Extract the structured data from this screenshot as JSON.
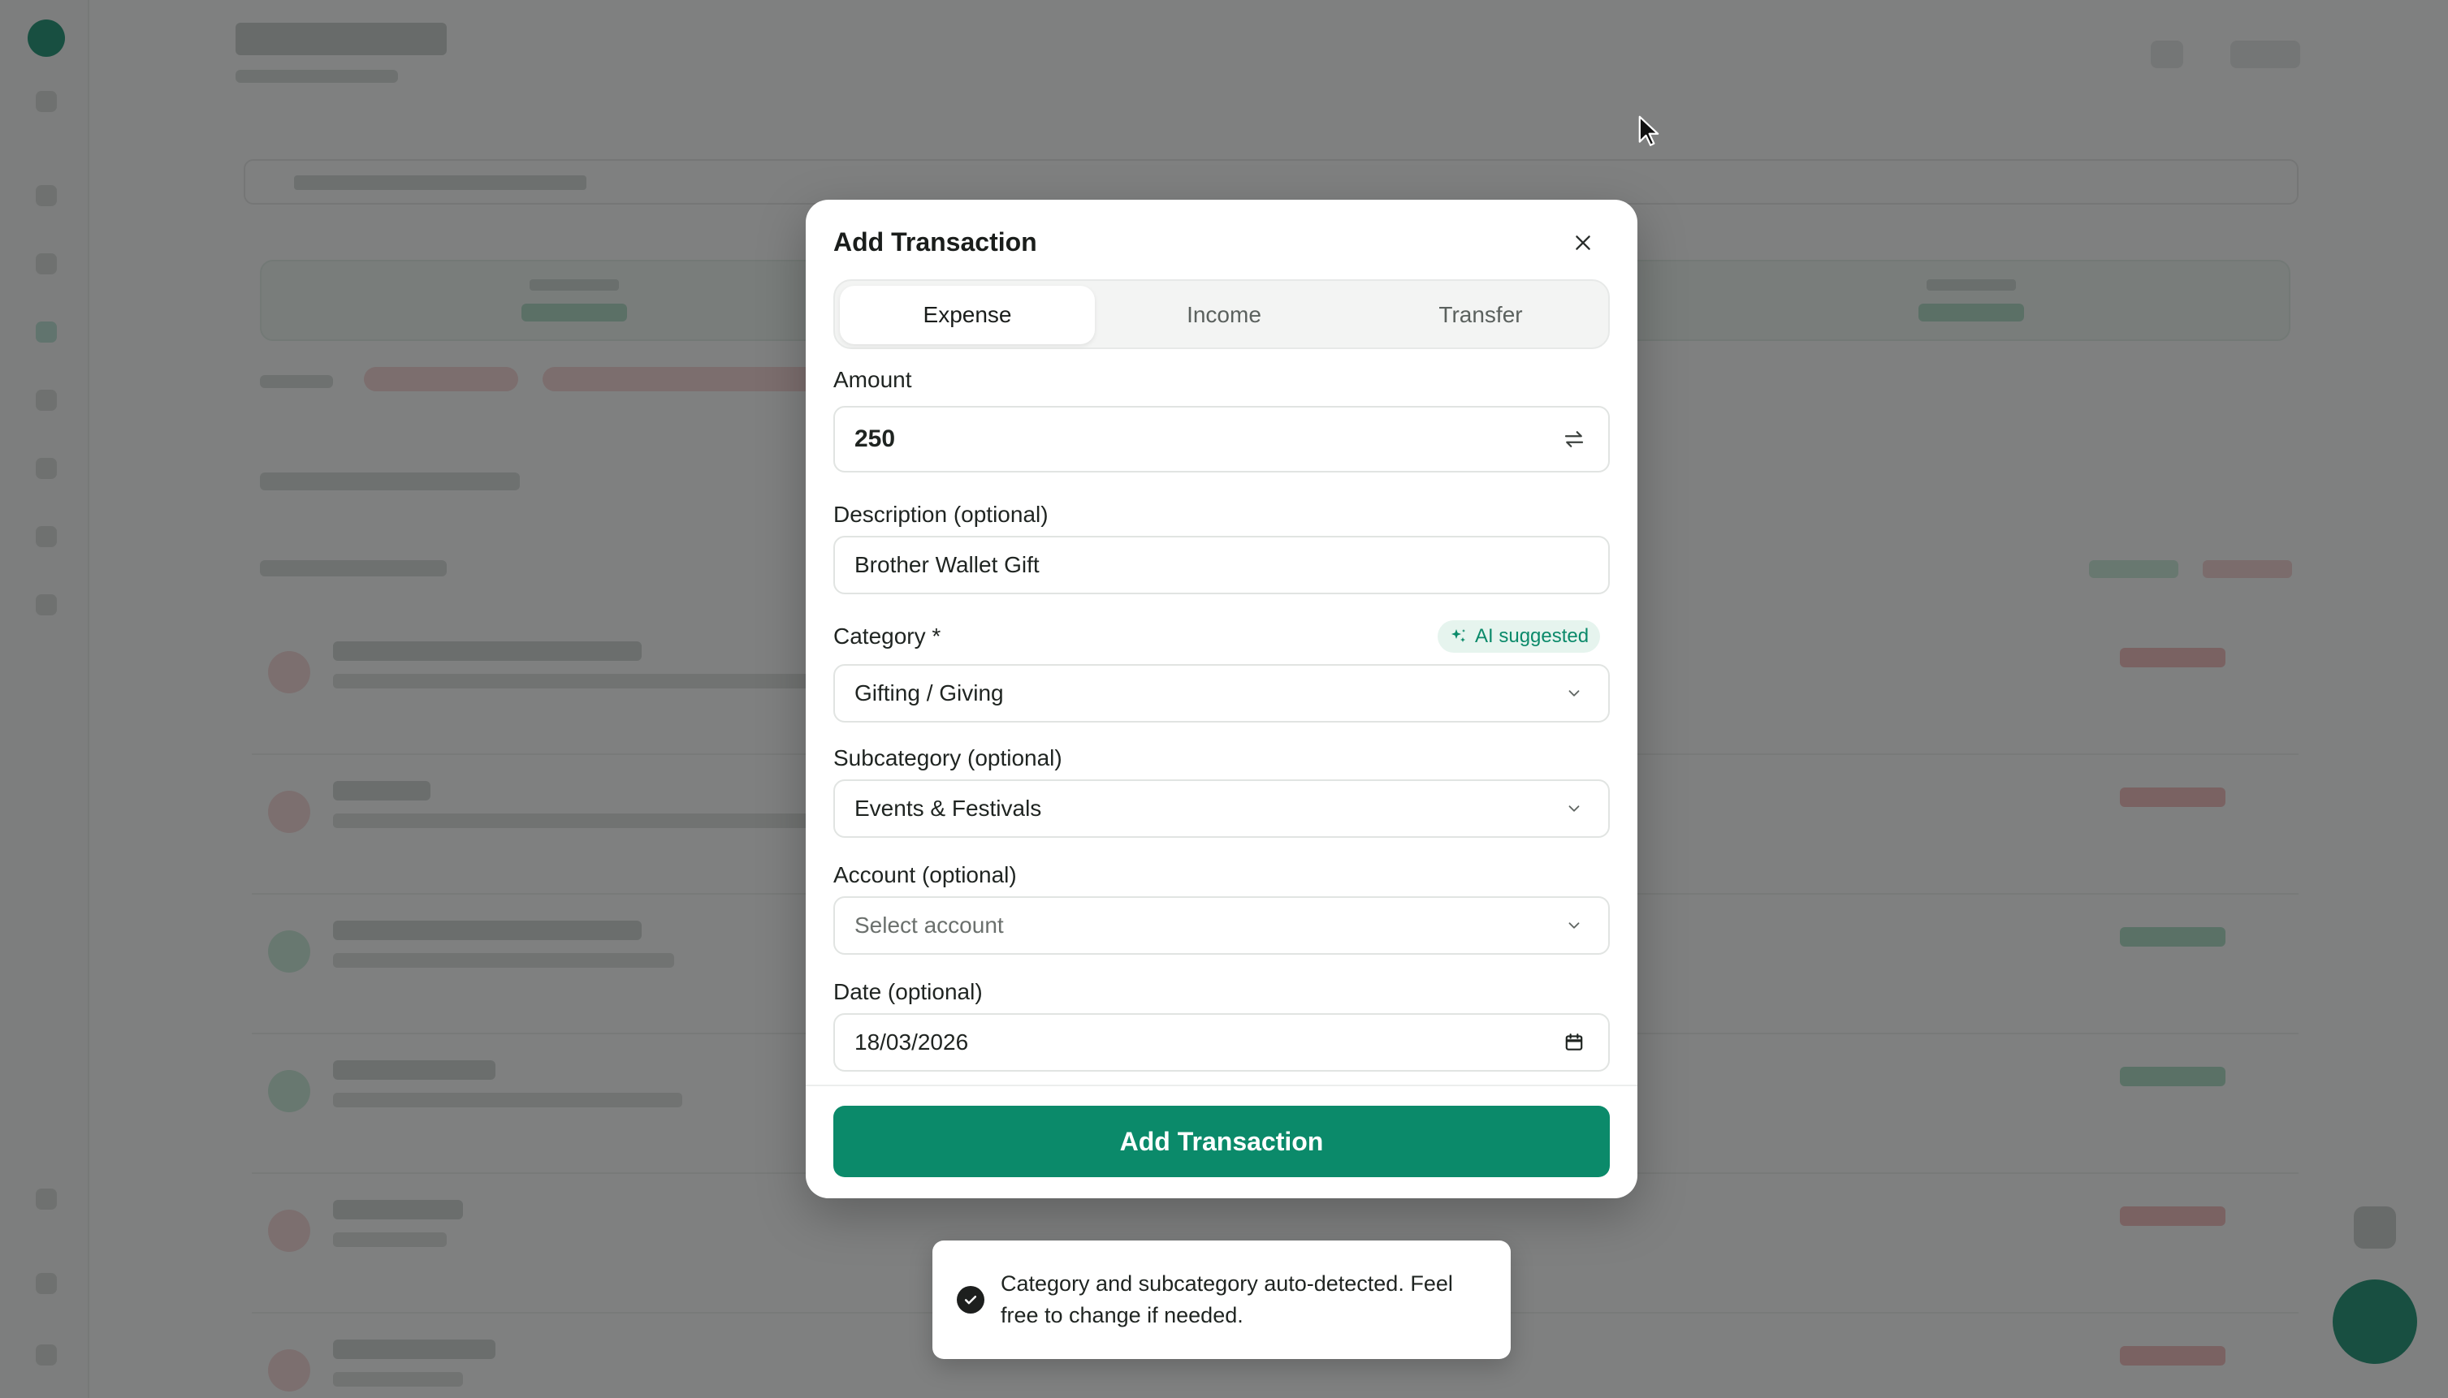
{
  "modal": {
    "title": "Add Transaction",
    "close_icon": "close-icon",
    "tabs": [
      {
        "label": "Expense",
        "active": true
      },
      {
        "label": "Income",
        "active": false
      },
      {
        "label": "Transfer",
        "active": false
      }
    ],
    "amount": {
      "label": "Amount",
      "value": "250",
      "icon": "swap-icon"
    },
    "description": {
      "label": "Description (optional)",
      "value": "Brother Wallet Gift"
    },
    "category": {
      "label": "Category *",
      "value": "Gifting / Giving",
      "badge": "AI suggested",
      "badge_icon": "sparkles-icon"
    },
    "subcategory": {
      "label": "Subcategory (optional)",
      "value": "Events & Festivals"
    },
    "account": {
      "label": "Account (optional)",
      "placeholder": "Select account"
    },
    "date": {
      "label": "Date (optional)",
      "value": "18/03/2026",
      "icon": "calendar-icon"
    },
    "submit_label": "Add Transaction"
  },
  "toast": {
    "icon": "check-circle-icon",
    "message": "Category and subcategory auto-detected. Feel free to change if needed."
  },
  "colors": {
    "accent": "#0b8a6a",
    "overlay": "#232424",
    "badge_bg": "#e6f4ee"
  }
}
